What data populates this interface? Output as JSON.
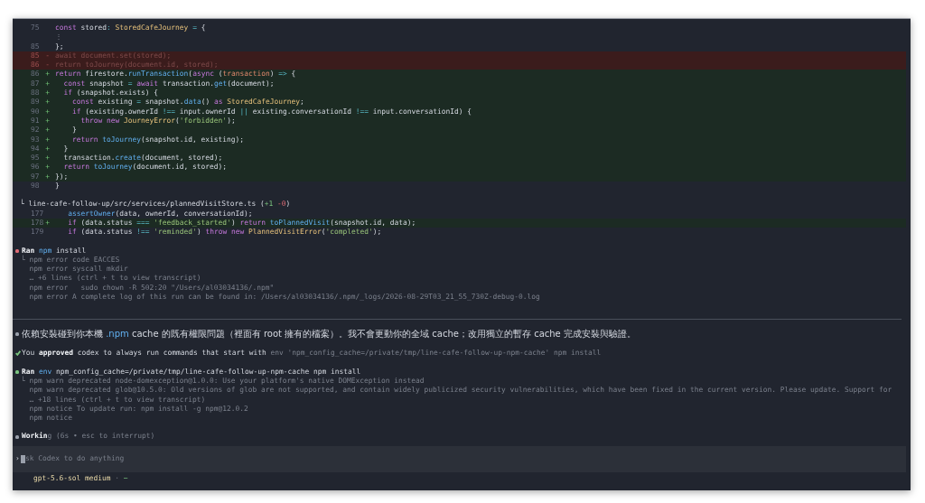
{
  "history": [
    {
      "kind": "diff",
      "lines": [
        {
          "kind": "context",
          "num": "75",
          "code": [
            {
              "kind": "keyword",
              "text": "const "
            },
            {
              "kind": "plain",
              "text": "stored"
            },
            {
              "kind": "operator",
              "text": ": "
            },
            {
              "kind": "type",
              "text": "StoredCafeJourney"
            },
            {
              "kind": "operator",
              "text": " = "
            },
            {
              "kind": "plain",
              "text": "{"
            }
          ]
        },
        {
          "kind": "gap",
          "code": [
            {
              "kind": "dim",
              "text": "⋮"
            }
          ]
        },
        {
          "kind": "context",
          "num": "85",
          "code": [
            {
              "kind": "plain",
              "text": "};"
            }
          ]
        },
        {
          "kind": "removed",
          "num": "85",
          "sign": "-",
          "code": [
            {
              "kind": "plain",
              "text": "await document.set(stored);"
            }
          ]
        },
        {
          "kind": "removed",
          "num": "86",
          "sign": "-",
          "code": [
            {
              "kind": "plain",
              "text": "return toJourney(document.id, stored);"
            }
          ]
        },
        {
          "kind": "added",
          "num": "86",
          "sign": "+",
          "code": [
            {
              "kind": "keyword",
              "text": "return "
            },
            {
              "kind": "plain",
              "text": "firestore."
            },
            {
              "kind": "function",
              "text": "runTransaction"
            },
            {
              "kind": "plain",
              "text": "("
            },
            {
              "kind": "keyword",
              "text": "async "
            },
            {
              "kind": "plain",
              "text": "("
            },
            {
              "kind": "param",
              "text": "transaction"
            },
            {
              "kind": "plain",
              "text": ") "
            },
            {
              "kind": "operator",
              "text": "=>"
            },
            {
              "kind": "plain",
              "text": " {"
            }
          ]
        },
        {
          "kind": "added",
          "num": "87",
          "sign": "+",
          "code": [
            {
              "kind": "keyword",
              "text": "  const "
            },
            {
              "kind": "plain",
              "text": "snapshot "
            },
            {
              "kind": "operator",
              "text": "= "
            },
            {
              "kind": "keyword",
              "text": "await "
            },
            {
              "kind": "plain",
              "text": "transaction."
            },
            {
              "kind": "function",
              "text": "get"
            },
            {
              "kind": "plain",
              "text": "(document);"
            }
          ]
        },
        {
          "kind": "added",
          "num": "88",
          "sign": "+",
          "code": [
            {
              "kind": "keyword",
              "text": "  if "
            },
            {
              "kind": "plain",
              "text": "(snapshot.exists) {"
            }
          ]
        },
        {
          "kind": "added",
          "num": "89",
          "sign": "+",
          "code": [
            {
              "kind": "keyword",
              "text": "    const "
            },
            {
              "kind": "plain",
              "text": "existing "
            },
            {
              "kind": "operator",
              "text": "= "
            },
            {
              "kind": "plain",
              "text": "snapshot."
            },
            {
              "kind": "function",
              "text": "data"
            },
            {
              "kind": "plain",
              "text": "() "
            },
            {
              "kind": "keyword",
              "text": "as "
            },
            {
              "kind": "type",
              "text": "StoredCafeJourney"
            },
            {
              "kind": "plain",
              "text": ";"
            }
          ]
        },
        {
          "kind": "added",
          "num": "90",
          "sign": "+",
          "code": [
            {
              "kind": "keyword",
              "text": "    if "
            },
            {
              "kind": "plain",
              "text": "(existing.ownerId "
            },
            {
              "kind": "operator",
              "text": "!== "
            },
            {
              "kind": "plain",
              "text": "input.ownerId "
            },
            {
              "kind": "operator",
              "text": "|| "
            },
            {
              "kind": "plain",
              "text": "existing.conversationId "
            },
            {
              "kind": "operator",
              "text": "!== "
            },
            {
              "kind": "plain",
              "text": "input.conversationId) {"
            }
          ]
        },
        {
          "kind": "added",
          "num": "91",
          "sign": "+",
          "code": [
            {
              "kind": "keyword",
              "text": "      throw new "
            },
            {
              "kind": "type",
              "text": "JourneyError"
            },
            {
              "kind": "plain",
              "text": "("
            },
            {
              "kind": "string",
              "text": "'forbidden'"
            },
            {
              "kind": "plain",
              "text": ");"
            }
          ]
        },
        {
          "kind": "added",
          "num": "92",
          "sign": "+",
          "code": [
            {
              "kind": "plain",
              "text": "    }"
            }
          ]
        },
        {
          "kind": "added",
          "num": "93",
          "sign": "+",
          "code": [
            {
              "kind": "keyword",
              "text": "    return "
            },
            {
              "kind": "function",
              "text": "toJourney"
            },
            {
              "kind": "plain",
              "text": "(snapshot.id, existing);"
            }
          ]
        },
        {
          "kind": "added",
          "num": "94",
          "sign": "+",
          "code": [
            {
              "kind": "plain",
              "text": "  }"
            }
          ]
        },
        {
          "kind": "added",
          "num": "95",
          "sign": "+",
          "code": [
            {
              "kind": "plain",
              "text": "  transaction."
            },
            {
              "kind": "function",
              "text": "create"
            },
            {
              "kind": "plain",
              "text": "(document, stored);"
            }
          ]
        },
        {
          "kind": "added",
          "num": "96",
          "sign": "+",
          "code": [
            {
              "kind": "keyword",
              "text": "  return "
            },
            {
              "kind": "function",
              "text": "toJourney"
            },
            {
              "kind": "plain",
              "text": "(document.id, stored);"
            }
          ]
        },
        {
          "kind": "added",
          "num": "97",
          "sign": "+",
          "code": [
            {
              "kind": "plain",
              "text": "});"
            }
          ]
        },
        {
          "kind": "context",
          "num": "98",
          "code": [
            {
              "kind": "plain",
              "text": "}"
            }
          ]
        }
      ]
    },
    {
      "kind": "diff",
      "header": [
        {
          "kind": "plain",
          "text": "└ line-cafe-follow-up/src/services/plannedVisitStore.ts ("
        },
        {
          "kind": "added",
          "text": "+1"
        },
        {
          "kind": "removed",
          "text": " -0"
        },
        {
          "kind": "plain",
          "text": ")"
        }
      ],
      "lines": [
        {
          "kind": "context",
          "num": "177",
          "code": [
            {
              "kind": "function",
              "text": "   assertOwner"
            },
            {
              "kind": "plain",
              "text": "(data, ownerId, conversationId);"
            }
          ]
        },
        {
          "kind": "added",
          "num": "178",
          "sign": "+",
          "code": [
            {
              "kind": "keyword",
              "text": "   if "
            },
            {
              "kind": "plain",
              "text": "(data.status "
            },
            {
              "kind": "operator",
              "text": "=== "
            },
            {
              "kind": "string",
              "text": "'feedback_started'"
            },
            {
              "kind": "plain",
              "text": ") "
            },
            {
              "kind": "keyword",
              "text": "return "
            },
            {
              "kind": "function",
              "text": "toPlannedVisit"
            },
            {
              "kind": "plain",
              "text": "(snapshot.id, data);"
            }
          ]
        },
        {
          "kind": "context",
          "num": "179",
          "code": [
            {
              "kind": "keyword",
              "text": "   if "
            },
            {
              "kind": "plain",
              "text": "(data.status "
            },
            {
              "kind": "operator",
              "text": "!== "
            },
            {
              "kind": "string",
              "text": "'reminded'"
            },
            {
              "kind": "plain",
              "text": ") "
            },
            {
              "kind": "keyword",
              "text": "throw new "
            },
            {
              "kind": "type",
              "text": "PlannedVisitError"
            },
            {
              "kind": "plain",
              "text": "("
            },
            {
              "kind": "string",
              "text": "'completed'"
            },
            {
              "kind": "plain",
              "text": ");"
            }
          ]
        }
      ]
    },
    {
      "kind": "exec",
      "color": "#e06c75",
      "title": [
        {
          "kind": "bold",
          "text": "Ran"
        },
        {
          "kind": "command",
          "text": " npm"
        },
        {
          "kind": "plain",
          "text": " install"
        }
      ],
      "output": [
        "└ npm error code EACCES",
        "npm error syscall mkdir",
        "… +6 lines (ctrl + t to view transcript)",
        "npm error   sudo chown -R 502:20 \"/Users/al03034136/.npm\"",
        "npm error A complete log of this run can be found in: /Users/al03034136/.npm/_logs/2026-08-29T03_21_55_730Z-debug-0.log"
      ]
    }
  ],
  "turn": [
    {
      "kind": "message",
      "color": "#9aa0ab",
      "title": [
        {
          "kind": "plain",
          "text": "依賴安裝碰到你本機 "
        },
        {
          "kind": "command",
          "text": ".npm"
        },
        {
          "kind": "plain",
          "text": " cache 的既有權限問題（裡面有 root 擁有的檔案）。我不會更動你的全域 cache；改用獨立的暫存 cache 完成安裝與驗證。"
        }
      ]
    },
    {
      "kind": "approval",
      "color": "#7bc47f",
      "title": [
        {
          "kind": "plain",
          "text": "You "
        },
        {
          "kind": "bold",
          "text": "approved"
        },
        {
          "kind": "plain",
          "text": " codex to always run commands that start with "
        },
        {
          "kind": "dim",
          "text": "env 'npm_config_cache=/private/tmp/line-cafe-follow-up-npm-cache' npm install"
        }
      ]
    },
    {
      "kind": "exec",
      "color": "#7bc47f",
      "title": [
        {
          "kind": "bold",
          "text": "Ran"
        },
        {
          "kind": "command",
          "text": " env"
        },
        {
          "kind": "plain",
          "text": " npm_config_cache=/private/tmp/line-cafe-follow-up-npm-cache npm install"
        }
      ],
      "output": [
        "└ npm warn deprecated node-domexception@1.0.0: Use your platform's native DOMException instead",
        "npm warn deprecated glob@10.5.0: Old versions of glob are not supported, and contain widely publicized security vulnerabilities, which have been fixed in the current version. Please update. Support for",
        "… +18 lines (ctrl + t to view transcript)",
        "npm notice To update run: npm install -g npm@12.0.2",
        "npm notice"
      ]
    },
    {
      "kind": "working",
      "color": "#9aa0ab",
      "title": [
        {
          "kind": "bold",
          "text": "Workin"
        },
        {
          "kind": "dim",
          "text": "g (6s • esc to interrupt)"
        }
      ]
    }
  ],
  "composer": {
    "prompt": "›",
    "placeholder": "sk Codex to do anything"
  },
  "status_bar": [
    {
      "kind": "model",
      "text": "gpt-5.6-sol medium"
    },
    {
      "kind": "dim",
      "text": " · "
    },
    {
      "kind": "path",
      "text": "~"
    }
  ]
}
